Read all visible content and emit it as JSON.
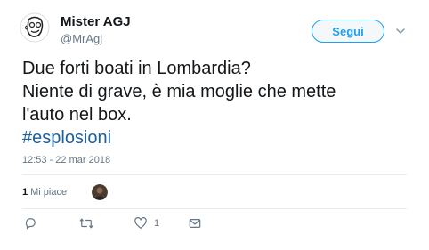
{
  "tweet": {
    "author_name": "Mister AGJ",
    "author_handle": "@MrAgj",
    "follow_label": "Segui",
    "text_lines": [
      "Due forti boati in Lombardia?",
      "Niente di grave, è mia moglie che mette",
      "l'auto nel box."
    ],
    "hashtag": "#esplosioni",
    "timestamp": "12:53 - 22 mar 2018",
    "likes_count": "1",
    "likes_label": "Mi piace",
    "like_action_count": "1"
  },
  "colors": {
    "accent": "#1da1f2",
    "hashtag": "#1b60a3",
    "muted": "#657786",
    "text": "#14171a"
  },
  "icons": [
    "caret-down-icon",
    "reply-icon",
    "retweet-icon",
    "heart-icon",
    "direct-message-icon"
  ]
}
